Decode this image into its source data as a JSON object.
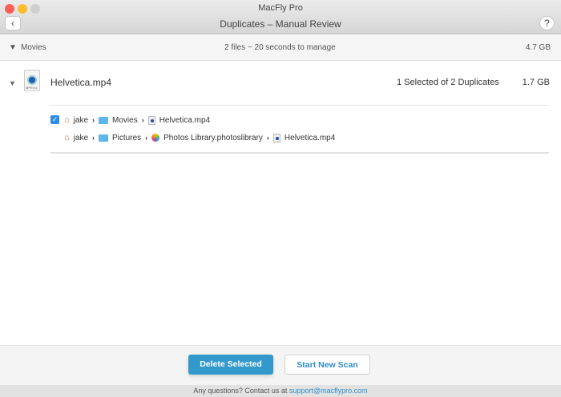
{
  "window": {
    "app_title": "MacFly Pro",
    "title": "Duplicates – Manual Review",
    "back_icon": "‹",
    "help_label": "?"
  },
  "group": {
    "name": "Movies",
    "summary": "2 files ~ 20 seconds to manage",
    "size": "4.7 GB"
  },
  "file": {
    "name": "Helvetica.mp4",
    "icon_label": "MPEG4",
    "selection": "1 Selected of 2 Duplicates",
    "size": "1.7 GB"
  },
  "paths": [
    {
      "checked": true,
      "segments": [
        "jake",
        "Movies",
        "Helvetica.mp4"
      ]
    },
    {
      "checked": false,
      "segments": [
        "jake",
        "Pictures",
        "Photos Library.photoslibrary",
        "Helvetica.mp4"
      ]
    }
  ],
  "buttons": {
    "delete": "Delete Selected",
    "new_scan": "Start New Scan"
  },
  "status": {
    "text": "Any questions? Contact us at",
    "email": "support@macflypro.com"
  },
  "colors": {
    "accent": "#3399cc",
    "link": "#2e8ecb"
  }
}
